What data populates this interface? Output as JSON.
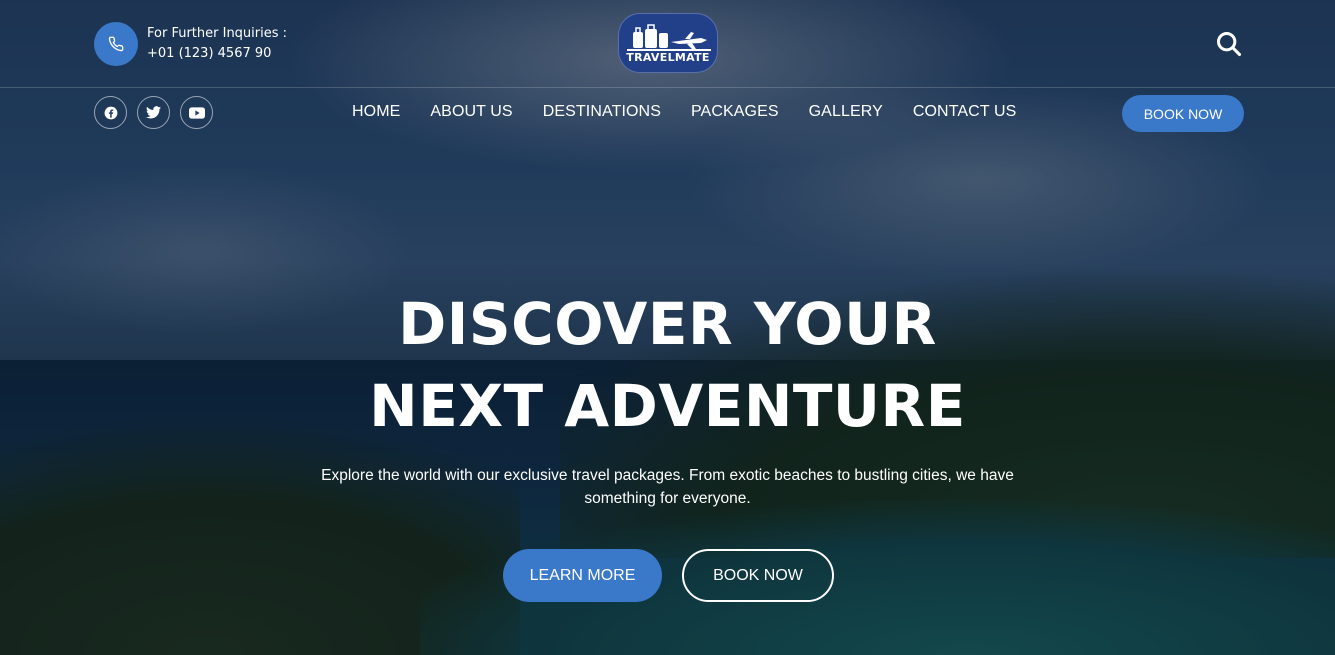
{
  "contact": {
    "label": "For Further Inquiries :",
    "phone": "+01 (123) 4567 90",
    "icon": "phone-icon"
  },
  "logo": {
    "text": "TRAVELMATE"
  },
  "header": {
    "search_icon": "search-icon"
  },
  "social": [
    {
      "name": "facebook-icon"
    },
    {
      "name": "twitter-icon"
    },
    {
      "name": "youtube-icon"
    }
  ],
  "nav": {
    "items": [
      {
        "label": "HOME"
      },
      {
        "label": "ABOUT US"
      },
      {
        "label": "DESTINATIONS"
      },
      {
        "label": "PACKAGES"
      },
      {
        "label": "GALLERY"
      },
      {
        "label": "CONTACT US"
      }
    ],
    "book_label": "BOOK NOW"
  },
  "hero": {
    "line1": "DISCOVER YOUR",
    "line2": "NEXT ADVENTURE",
    "subtext": "Explore the world with our exclusive travel packages. From exotic beaches to bustling cities, we have something for everyone.",
    "learn_more": "LEARN MORE",
    "book_now": "BOOK NOW"
  },
  "colors": {
    "accent": "#3a78c9",
    "logo_bg": "#223f8a",
    "text": "#ffffff"
  }
}
